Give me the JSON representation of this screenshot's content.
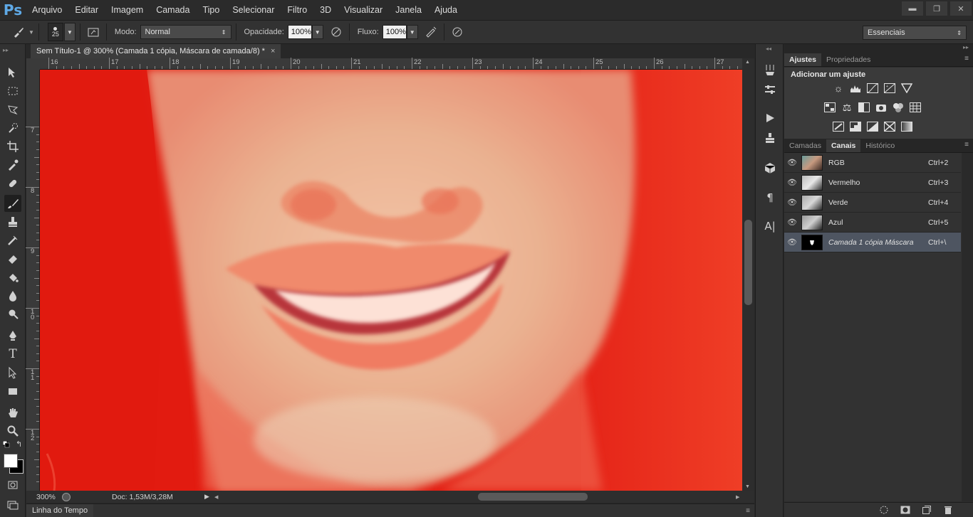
{
  "app": {
    "logo": "Ps"
  },
  "menu": [
    "Arquivo",
    "Editar",
    "Imagem",
    "Camada",
    "Tipo",
    "Selecionar",
    "Filtro",
    "3D",
    "Visualizar",
    "Janela",
    "Ajuda"
  ],
  "window_controls": {
    "minimize": "▬",
    "restore": "❐",
    "close": "✕"
  },
  "options": {
    "brush_size": "25",
    "mode_label": "Modo:",
    "mode_value": "Normal",
    "opacity_label": "Opacidade:",
    "opacity_value": "100%",
    "flow_label": "Fluxo:",
    "flow_value": "100%",
    "workspace": "Essenciais"
  },
  "document": {
    "tab_title": "Sem Título-1 @ 300% (Camada 1 cópia, Máscara de camada/8) *",
    "close": "×",
    "ruler_top": [
      "16",
      "17",
      "18",
      "19",
      "20",
      "21",
      "22",
      "23",
      "24",
      "25",
      "26",
      "27"
    ],
    "ruler_left": [
      "7",
      "8",
      "9",
      "1\n0",
      "1\n1",
      "1\n2"
    ]
  },
  "status": {
    "zoom": "300%",
    "doc_info": "Doc: 1,53M/3,28M"
  },
  "timeline": {
    "label": "Linha do Tempo"
  },
  "adjustments": {
    "tabs": [
      "Ajustes",
      "Propriedades"
    ],
    "title": "Adicionar um ajuste"
  },
  "channels": {
    "tabs": [
      "Camadas",
      "Canais",
      "Histórico"
    ],
    "rows": [
      {
        "name": "RGB",
        "shortcut": "Ctrl+2"
      },
      {
        "name": "Vermelho",
        "shortcut": "Ctrl+3"
      },
      {
        "name": "Verde",
        "shortcut": "Ctrl+4"
      },
      {
        "name": "Azul",
        "shortcut": "Ctrl+5"
      },
      {
        "name": "Camada 1 cópia Máscara",
        "shortcut": "Ctrl+\\"
      }
    ]
  },
  "colors": {
    "overlay_red": "#e31b12",
    "panel_bg": "#323232",
    "selected_row": "#4e5561",
    "ps_blue": "#5fa9e6"
  }
}
